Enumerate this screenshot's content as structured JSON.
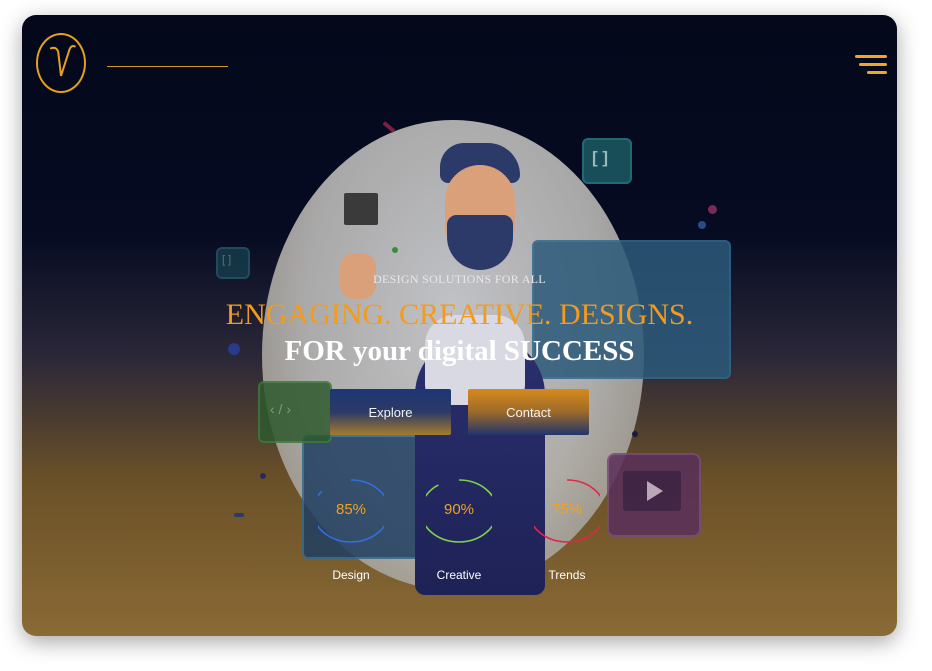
{
  "hero": {
    "eyebrow": "DESIGN SOLUTIONS FOR ALL",
    "headline": "ENGAGING. CREATIVE. DESIGNS.",
    "subline": "FOR your digital SUCCESS"
  },
  "buttons": {
    "explore_label": "Explore",
    "contact_label": "Contact"
  },
  "stats": [
    {
      "label": "Design",
      "value": "85%",
      "percent": 85,
      "color": "#2f6fe0"
    },
    {
      "label": "Creative",
      "value": "90%",
      "percent": 90,
      "color": "#7fd44a"
    },
    {
      "label": "Trends",
      "value": "75%",
      "percent": 75,
      "color": "#e0264a"
    }
  ],
  "illustration": {
    "code_bracket_glyph": "[ ]",
    "code_tag_glyph": "‹ / ›"
  },
  "colors": {
    "accent": "#f29b1e",
    "background_top": "#04081a",
    "background_bottom": "#8a6a35"
  },
  "icons": {
    "logo": "v-logo-icon",
    "menu": "hamburger-menu-icon"
  }
}
